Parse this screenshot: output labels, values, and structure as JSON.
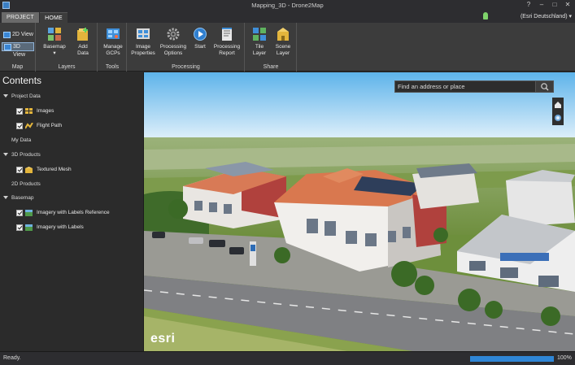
{
  "window": {
    "title": "Mapping_3D - Drone2Map",
    "controls": [
      "?",
      "–",
      "□",
      "✕"
    ]
  },
  "tabs": [
    {
      "label": "PROJECT",
      "active": false
    },
    {
      "label": "HOME",
      "active": true
    }
  ],
  "portal": {
    "label": "(Esri Deutschland)"
  },
  "ribbon": {
    "groups": {
      "map": {
        "label": "Map",
        "view_2d": "2D View",
        "view_3d": "3D View",
        "selected": "3D View"
      },
      "layers": {
        "label": "Layers",
        "basemap": "Basemap",
        "add_data_1": "Add",
        "add_data_2": "Data"
      },
      "tools": {
        "label": "Tools",
        "manage_gcps_1": "Manage",
        "manage_gcps_2": "GCPs"
      },
      "processing": {
        "label": "Processing",
        "image_props_1": "Image",
        "image_props_2": "Properties",
        "proc_options_1": "Processing",
        "proc_options_2": "Options",
        "start": "Start",
        "proc_report_1": "Processing",
        "proc_report_2": "Report"
      },
      "share": {
        "label": "Share",
        "tile_layer_1": "Tile",
        "tile_layer_2": "Layer",
        "scene_layer_1": "Scene",
        "scene_layer_2": "Layer"
      }
    }
  },
  "contents": {
    "title": "Contents",
    "project_data": "Project Data",
    "images": "Images",
    "flight_path": "Flight Path",
    "my_data": "My Data",
    "products_3d": "3D Products",
    "textured_mesh": "Textured Mesh",
    "products_2d": "2D Products",
    "basemap": "Basemap",
    "imagery_labels_ref": "Imagery with Labels Reference",
    "imagery_labels": "Imagery with Labels"
  },
  "map": {
    "search_placeholder": "Find an address or place",
    "logo_text": "esri"
  },
  "status": {
    "text": "Ready.",
    "progress": 1.0,
    "progress_label": "100%"
  },
  "colors": {
    "accent": "#2f86d6",
    "panel": "#2b2b2b",
    "ribbon": "#3c3c3c"
  }
}
